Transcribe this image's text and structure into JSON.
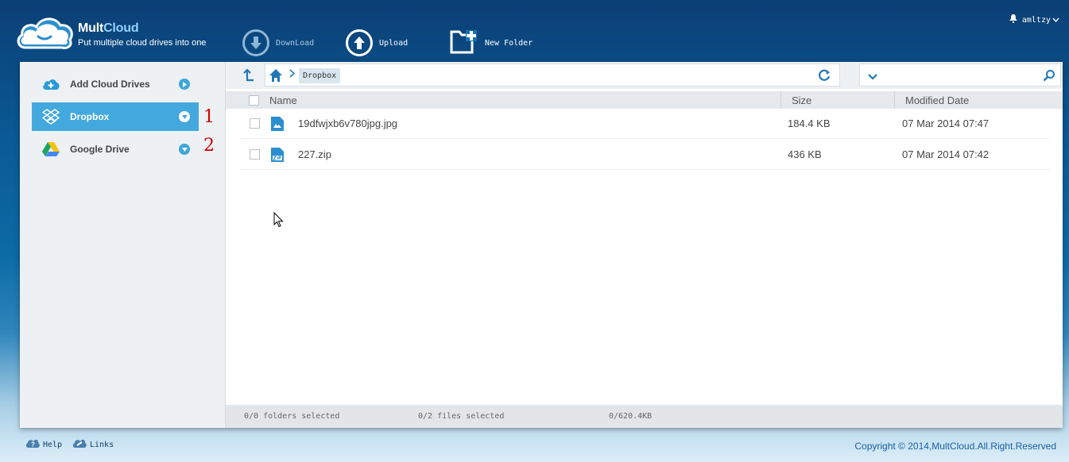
{
  "app": {
    "brand_mult": "Mult",
    "brand_cloud": "Cloud",
    "tagline": "Put multiple cloud drives into one"
  },
  "toolbar": {
    "download_label": "DownLoad",
    "upload_label": "Upload",
    "new_folder_label": "New Folder"
  },
  "user": {
    "name": "amltzy"
  },
  "sidebar": {
    "items": [
      {
        "label": "Add Cloud Drives",
        "icon": "add-cloud-icon"
      },
      {
        "label": "Dropbox",
        "icon": "dropbox-icon",
        "active": true
      },
      {
        "label": "Google Drive",
        "icon": "google-drive-icon"
      }
    ],
    "annotations": [
      "1",
      "2"
    ]
  },
  "breadcrumb": {
    "current": "Dropbox"
  },
  "search": {
    "placeholder": ""
  },
  "table": {
    "columns": [
      "Name",
      "Size",
      "Modified Date"
    ],
    "rows": [
      {
        "name": "19dfwjxb6v780jpg.jpg",
        "size": "184.4 KB",
        "date": "07 Mar 2014 07:47",
        "type": "image"
      },
      {
        "name": "227.zip",
        "size": "436 KB",
        "date": "07 Mar 2014 07:42",
        "type": "zip"
      }
    ]
  },
  "status": {
    "folders": "0/0 folders selected",
    "files": "0/2 files selected",
    "size": "0/620.4KB"
  },
  "footer": {
    "help": "Help",
    "links": "Links",
    "copyright": "Copyright © 2014,MultCloud.All.Right.Reserved"
  },
  "colors": {
    "accent": "#43a8dd",
    "link": "#2177b7",
    "annotation": "#d40000"
  }
}
